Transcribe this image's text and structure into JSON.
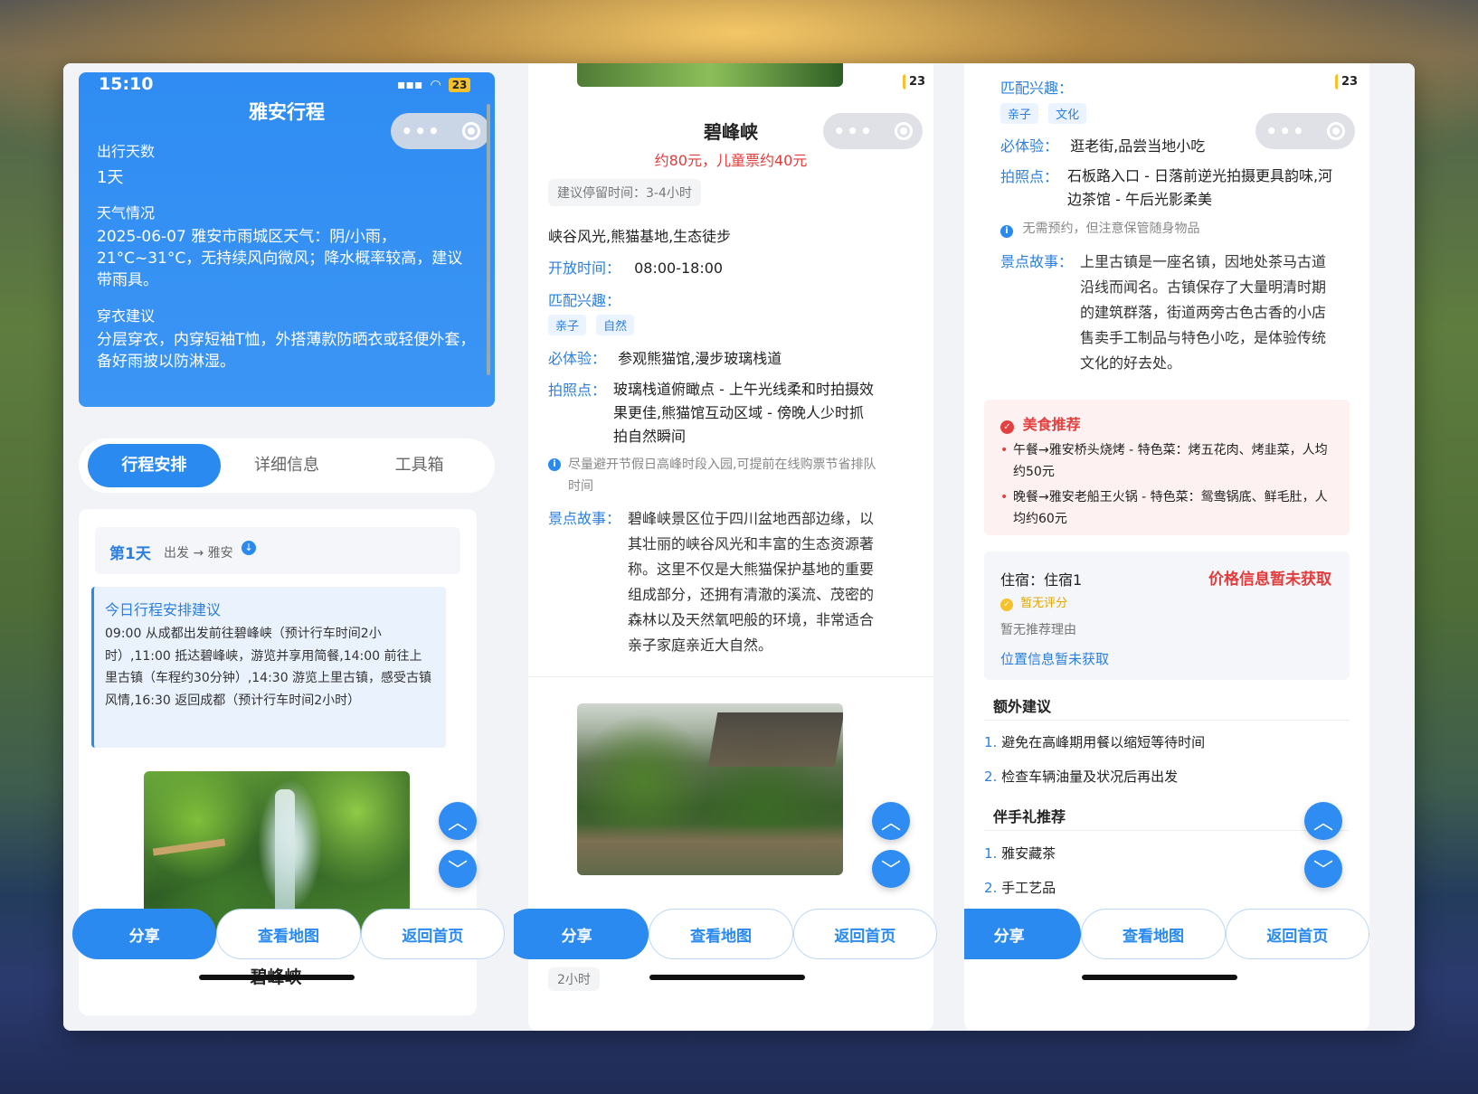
{
  "panel1": {
    "status": {
      "time": "15:10",
      "battery": "23"
    },
    "header": {
      "title": "雅安行程"
    },
    "trip": {
      "days_label": "出行天数",
      "days_value": "1天",
      "weather_label": "天气情况",
      "weather_value": "2025-06-07 雅安市雨城区天气：阴/小雨，21°C~31°C，无持续风向微风；降水概率较高，建议带雨具。",
      "clothing_label": "穿衣建议",
      "clothing_value": "分层穿衣，内穿短袖T恤，外搭薄款防晒衣或轻便外套，备好雨披以防淋湿。"
    },
    "tabs": [
      "行程安排",
      "详细信息",
      "工具箱"
    ],
    "day": {
      "label": "第1天",
      "route": "出发 → 雅安"
    },
    "suggestion": {
      "title": "今日行程安排建议",
      "body": "09:00 从成都出发前往碧峰峡（预计行车时间2小时）,11:00 抵达碧峰峡，游览并享用简餐,14:00 前往上里古镇（车程约30分钟）,14:30 游览上里古镇，感受古镇风情,16:30 返回成都（预计行车时间2小时）"
    },
    "spot_title": "碧峰峡"
  },
  "panel2": {
    "battery": "23",
    "spot": {
      "name": "碧峰峡",
      "price": "约80元，儿童票约40元",
      "stay": "建议停留时间：3-4小时",
      "features": "峡谷风光,熊猫基地,生态徒步",
      "open_label": "开放时间：",
      "open_value": "08:00-18:00",
      "interest_label": "匹配兴趣：",
      "tags": [
        "亲子",
        "自然"
      ],
      "must_label": "必体验：",
      "must_value": "参观熊猫馆,漫步玻璃栈道",
      "photo_label": "拍照点：",
      "photo_value": "玻璃栈道俯瞰点 - 上午光线柔和时拍摄效果更佳,熊猫馆互动区域 - 傍晚人少时抓拍自然瞬间",
      "tip": "尽量避开节假日高峰时段入园,可提前在线购票节省排队时间",
      "story_label": "景点故事：",
      "story_value": "碧峰峡景区位于四川盆地西部边缘，以其壮丽的峡谷风光和丰富的生态资源著称。这里不仅是大熊猫保护基地的重要组成部分，还拥有清澈的溪流、茂密的森林以及天然氧吧般的环境，非常适合亲子家庭亲近大自然。"
    },
    "next_stay": "2小时"
  },
  "panel3": {
    "battery": "23",
    "interest_label": "匹配兴趣：",
    "tags": [
      "亲子",
      "文化"
    ],
    "must_label": "必体验：",
    "must_value": "逛老街,品尝当地小吃",
    "photo_label": "拍照点：",
    "photo_value": "石板路入口 - 日落前逆光拍摄更具韵味,河边茶馆 - 午后光影柔美",
    "tip": "无需预约，但注意保管随身物品",
    "story_label": "景点故事：",
    "story_value": "上里古镇是一座名镇，因地处茶马古道沿线而闻名。古镇保存了大量明清时期的建筑群落，街道两旁古色古香的小店售卖手工制品与特色小吃，是体验传统文化的好去处。",
    "food": {
      "title": "美食推荐",
      "items": [
        "午餐→雅安桥头烧烤 - 特色菜：烤五花肉、烤韭菜，人均约50元",
        "晚餐→雅安老船王火锅 - 特色菜：鸳鸯锅底、鲜毛肚，人均约60元"
      ]
    },
    "hotel": {
      "title": "住宿：住宿1",
      "price": "价格信息暂未获取",
      "rating": "暂无评分",
      "reason": "暂无推荐理由",
      "location": "位置信息暂未获取"
    },
    "extra": {
      "title": "额外建议",
      "items": [
        "避免在高峰期用餐以缩短等待时间",
        "检查车辆油量及状况后再出发"
      ]
    },
    "gifts": {
      "title": "伴手礼推荐",
      "items": [
        "雅安藏茶",
        "手工艺品"
      ]
    }
  },
  "bottom_bar": {
    "share": "分享",
    "map": "查看地图",
    "home": "返回首页"
  },
  "colors": {
    "accent": "#2a8af0",
    "price_red": "#e23b3b",
    "food_red": "#e34040"
  }
}
